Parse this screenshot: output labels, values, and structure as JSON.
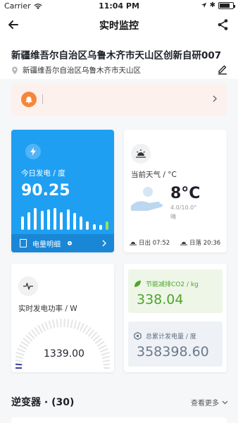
{
  "status_bar": {
    "carrier": "Carrier",
    "time": "11:04 PM"
  },
  "nav": {
    "title": "实时监控",
    "back_icon": "arrow-left-icon",
    "share_icon": "share-icon"
  },
  "site": {
    "name": "新疆维吾尔自治区乌鲁木齐市天山区创新自研007",
    "address": "新疆维吾尔自治区乌鲁木齐市天山区"
  },
  "alert": {
    "icon": "bell-icon",
    "color": "#f5873a"
  },
  "energy_card": {
    "label": "今日发电 / 度",
    "value": "90.25",
    "footer_label": "电量明细",
    "bar_levels": [
      0.55,
      0.75,
      0.9,
      0.8,
      0.85,
      0.9,
      0.75,
      0.85,
      0.7,
      0.55,
      0.35,
      0.25,
      0.2,
      0.35
    ],
    "accent_color": "#1f9ff2",
    "last_bar_color": "#9be05a"
  },
  "weather_card": {
    "label": "当前天气 / °C",
    "temperature": "8°C",
    "range": "4.0/10.0°",
    "condition": "晴",
    "sunrise": "日出 07:52",
    "sunset": "日落 20:36"
  },
  "power_card": {
    "label": "实时发电功率 / W",
    "value": "1339.00",
    "level": 0.04
  },
  "co2": {
    "label": "节能减排CO2 / kg",
    "value": "338.04",
    "color": "#4ea52a"
  },
  "total": {
    "label": "总累计发电量 / 度",
    "value": "358398.60"
  },
  "inverter": {
    "title": "逆变器 · (30)",
    "view_more": "查看更多"
  }
}
